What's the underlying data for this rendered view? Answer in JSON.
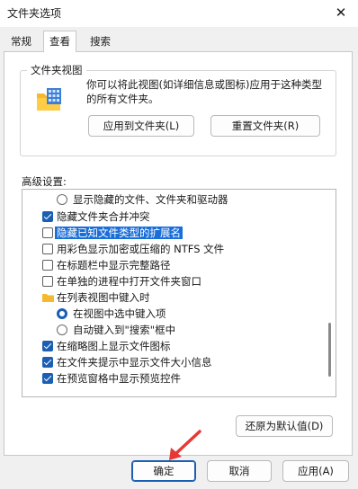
{
  "window": {
    "title": "文件夹选项",
    "close_icon": "close-icon"
  },
  "tabs": [
    {
      "label": "常规",
      "active": false
    },
    {
      "label": "查看",
      "active": true
    },
    {
      "label": "搜索",
      "active": false
    }
  ],
  "folder_views": {
    "group_title": "文件夹视图",
    "description": "你可以将此视图(如详细信息或图标)应用于这种类型的所有文件夹。",
    "apply_button": "应用到文件夹(L)",
    "reset_button": "重置文件夹(R)"
  },
  "advanced": {
    "label": "高级设置:",
    "items": [
      {
        "type": "radio",
        "checked": false,
        "label": "显示隐藏的文件、文件夹和驱动器"
      },
      {
        "type": "checkbox",
        "checked": true,
        "label": "隐藏文件夹合并冲突"
      },
      {
        "type": "checkbox",
        "checked": false,
        "label": "隐藏已知文件类型的扩展名",
        "selected": true
      },
      {
        "type": "checkbox",
        "checked": false,
        "label": "用彩色显示加密或压缩的 NTFS 文件"
      },
      {
        "type": "checkbox",
        "checked": false,
        "label": "在标题栏中显示完整路径"
      },
      {
        "type": "checkbox",
        "checked": false,
        "label": "在单独的进程中打开文件夹窗口"
      },
      {
        "type": "folder",
        "label": "在列表视图中键入时"
      },
      {
        "type": "radio",
        "checked": true,
        "label": "在视图中选中键入项"
      },
      {
        "type": "radio",
        "checked": false,
        "label": "自动键入到\"搜索\"框中"
      },
      {
        "type": "checkbox",
        "checked": true,
        "label": "在缩略图上显示文件图标"
      },
      {
        "type": "checkbox",
        "checked": true,
        "label": "在文件夹提示中显示文件大小信息"
      },
      {
        "type": "checkbox",
        "checked": true,
        "label": "在预览窗格中显示预览控件"
      }
    ],
    "restore_button": "还原为默认值(D)"
  },
  "footer": {
    "ok": "确定",
    "cancel": "取消",
    "apply": "应用(A)"
  },
  "colors": {
    "accent": "#1a5fb4",
    "selection": "#1a6ed8",
    "annotation_arrow": "#e53935"
  }
}
